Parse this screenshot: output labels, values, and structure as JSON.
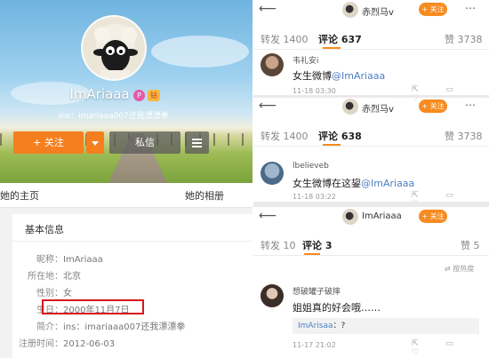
{
  "colors": {
    "accent": "#f78b1f",
    "highlight_box": "#d6171c",
    "link": "#4d7fc4"
  },
  "profile": {
    "username": "ImAriaaa",
    "badge_vip": "P",
    "badge_level": "钻",
    "ins_line": "ins：imariaaa007还我漂漂拳",
    "follow_button": "+ 关注",
    "dropdown_icon": "chevron-down-icon",
    "message_button": "私信",
    "menu_icon": "menu-icon",
    "tab_home": "她的主页",
    "tab_album": "她的相册",
    "info_title": "基本信息",
    "rows": [
      {
        "label": "昵称：",
        "value": "ImAriaaa"
      },
      {
        "label": "所在地：",
        "value": "北京"
      },
      {
        "label": "性别：",
        "value": "女"
      },
      {
        "label": "生日：",
        "value": "2000年11月7日"
      },
      {
        "label": "简介：",
        "value": "ins：imariaaa007还我漂漂拳"
      },
      {
        "label": "注册时间：",
        "value": "2012-06-03"
      }
    ]
  },
  "screens": [
    {
      "header_name": "赤烈马v",
      "follow_pill": "+ 关注",
      "tab_repost": "转发 1400",
      "tab_comment": "评论 637",
      "tab_like": "赞 3738",
      "comment_user": "韦礼安i",
      "comment_text": "女生微博",
      "comment_link": "@ImAriaaa",
      "comment_time": "11-18 03:30",
      "icons": "⇱ ▭ ♡"
    },
    {
      "header_name": "赤烈马v",
      "follow_pill": "+ 关注",
      "tab_repost": "转发 1400",
      "tab_comment": "评论 638",
      "tab_like": "赞 3738",
      "comment_user": "lbelieveb",
      "comment_text": "女生微博在这鋆",
      "comment_link": "@ImAriaaa",
      "comment_time": "11-18 03:22",
      "icons": "⇱ ▭ ♡"
    },
    {
      "header_name": "ImAriaaa",
      "follow_pill": "+ 关注",
      "tab_repost": "转发 10",
      "tab_comment": "评论 3",
      "tab_like": "赞 5",
      "sort_label": "⇄ 按热度",
      "comment_user": "想破罐子破摔",
      "comment_text": "姐姐真的好会哦……",
      "reply_user": "ImArisaa",
      "reply_text": "：?",
      "comment_time": "11-17 21:02",
      "icons": "⇱ ▭ ♡"
    }
  ]
}
